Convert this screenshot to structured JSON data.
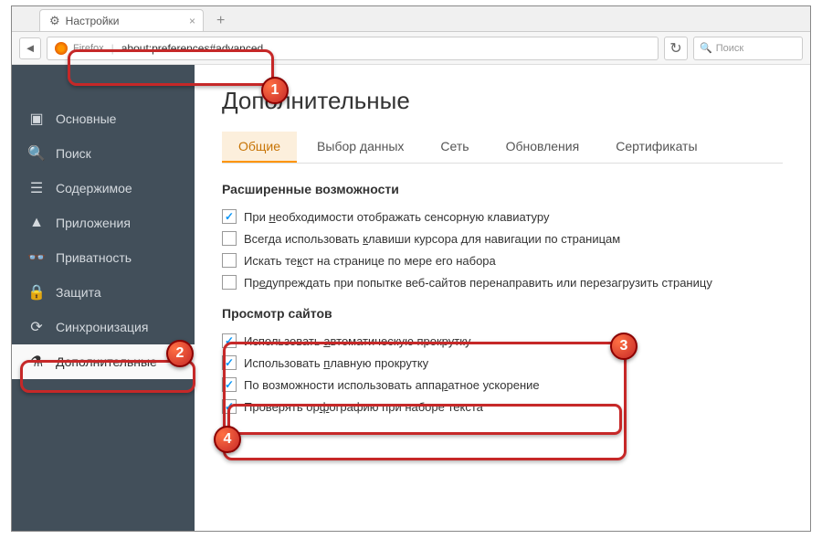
{
  "tab": {
    "title": "Настройки"
  },
  "url": {
    "prefix": "Firefox",
    "value": "about:preferences#advanced"
  },
  "search": {
    "placeholder": "Поиск"
  },
  "sidebar": {
    "items": [
      {
        "label": "Основные"
      },
      {
        "label": "Поиск"
      },
      {
        "label": "Содержимое"
      },
      {
        "label": "Приложения"
      },
      {
        "label": "Приватность"
      },
      {
        "label": "Защита"
      },
      {
        "label": "Синхронизация"
      },
      {
        "label": "Дополнительные"
      }
    ]
  },
  "page": {
    "title": "Дополнительные",
    "tabs": [
      {
        "label": "Общие"
      },
      {
        "label": "Выбор данных"
      },
      {
        "label": "Сеть"
      },
      {
        "label": "Обновления"
      },
      {
        "label": "Сертификаты"
      }
    ]
  },
  "sections": {
    "a": {
      "title": "Расширенные возможности",
      "items": [
        {
          "checked": true,
          "pre": "При ",
          "ul": "н",
          "post": "еобходимости отображать сенсорную клавиатуру"
        },
        {
          "checked": false,
          "pre": "Всегда использовать ",
          "ul": "к",
          "post": "лавиши курсора для навигации по страницам"
        },
        {
          "checked": false,
          "pre": "Искать те",
          "ul": "к",
          "post": "ст на странице по мере его набора"
        },
        {
          "checked": false,
          "pre": "Пр",
          "ul": "е",
          "post": "дупреждать при попытке веб-сайтов перенаправить или перезагрузить страницу"
        }
      ]
    },
    "b": {
      "title": "Просмотр сайтов",
      "items": [
        {
          "checked": true,
          "pre": "Использовать ",
          "ul": "а",
          "post": "втоматическую прокрутку"
        },
        {
          "checked": true,
          "pre": "Использовать ",
          "ul": "п",
          "post": "лавную прокрутку"
        },
        {
          "checked": true,
          "pre": "По возможности использовать аппа",
          "ul": "р",
          "post": "атное ускорение"
        },
        {
          "checked": true,
          "pre": "Проверять ор",
          "ul": "ф",
          "post": "ографию при наборе текста"
        }
      ]
    }
  },
  "badges": {
    "1": "1",
    "2": "2",
    "3": "3",
    "4": "4"
  }
}
